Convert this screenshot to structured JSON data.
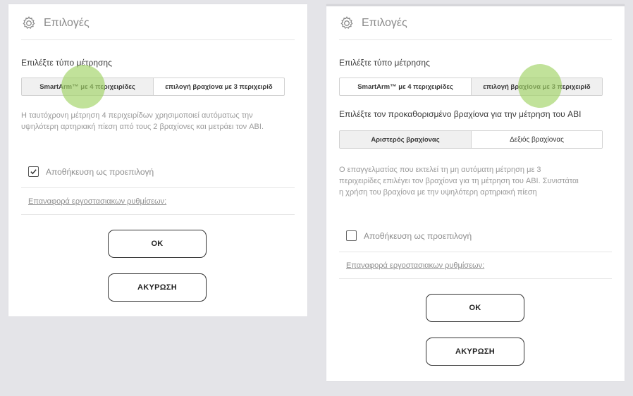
{
  "left": {
    "title": "Επιλογές",
    "measurement_label": "Επιλέξτε τύπο μέτρησης",
    "measurement_options": [
      "SmartArm™ με 4 περιχειρίδες",
      "επιλογή βραχίονα με 3 περιχειρίδ"
    ],
    "selected_option": 0,
    "description": "Η ταυτόχρονη μέτρηση 4 περιχειρίδων χρησιμοποιεί αυτόματως την υψηλότερη αρτηριακή πίεση από τους 2 βραχίονες και μετράει τον ABI.",
    "save_default_label": "Αποθήκευση ως προεπιλογή",
    "save_default_checked": true,
    "reset_link": "Επαναφορά εργοστασιακων ρυθμίσεων:",
    "ok_label": "ΟΚ",
    "cancel_label": "ΑΚΥΡΩΣΗ"
  },
  "right": {
    "title": "Επιλογές",
    "measurement_label": "Επιλέξτε τύπο μέτρησης",
    "measurement_options": [
      "SmartArm™ με 4 περιχειρίδες",
      "επιλογή βραχίονα με 3 περιχειρίδ"
    ],
    "selected_option": 1,
    "arm_label": "Επιλέξτε τον προκαθορισμένο βραχίονα για την μέτρηση του ABI",
    "arm_options": [
      "Αριστερός βραχίονας",
      "Δεξιός βραχίονας"
    ],
    "selected_arm": 0,
    "description": "Ο επαγγελματίας που εκτελεί τη μη αυτόματη μέτρηση με 3 περιχειρίδες επιλέγει τον βραχίονα για τη μέτρηση του ABI. Συνιστάται η χρήση του βραχίονα με την υψηλότερη αρτηριακή πίεση",
    "save_default_label": "Αποθήκευση ως προεπιλογή",
    "save_default_checked": false,
    "reset_link": "Επαναφορά εργοστασιακων ρυθμίσεων:",
    "ok_label": "ΟΚ",
    "cancel_label": "ΑΚΥΡΩΣΗ"
  },
  "colors": {
    "panel_bg": "#ffffff",
    "page_bg": "#e4e4e8",
    "touch_indicator": "#a0d264",
    "selected_segment_bg": "#f0f0f0"
  },
  "icons": {
    "header": "gear-icon",
    "check": "checkmark-icon"
  }
}
